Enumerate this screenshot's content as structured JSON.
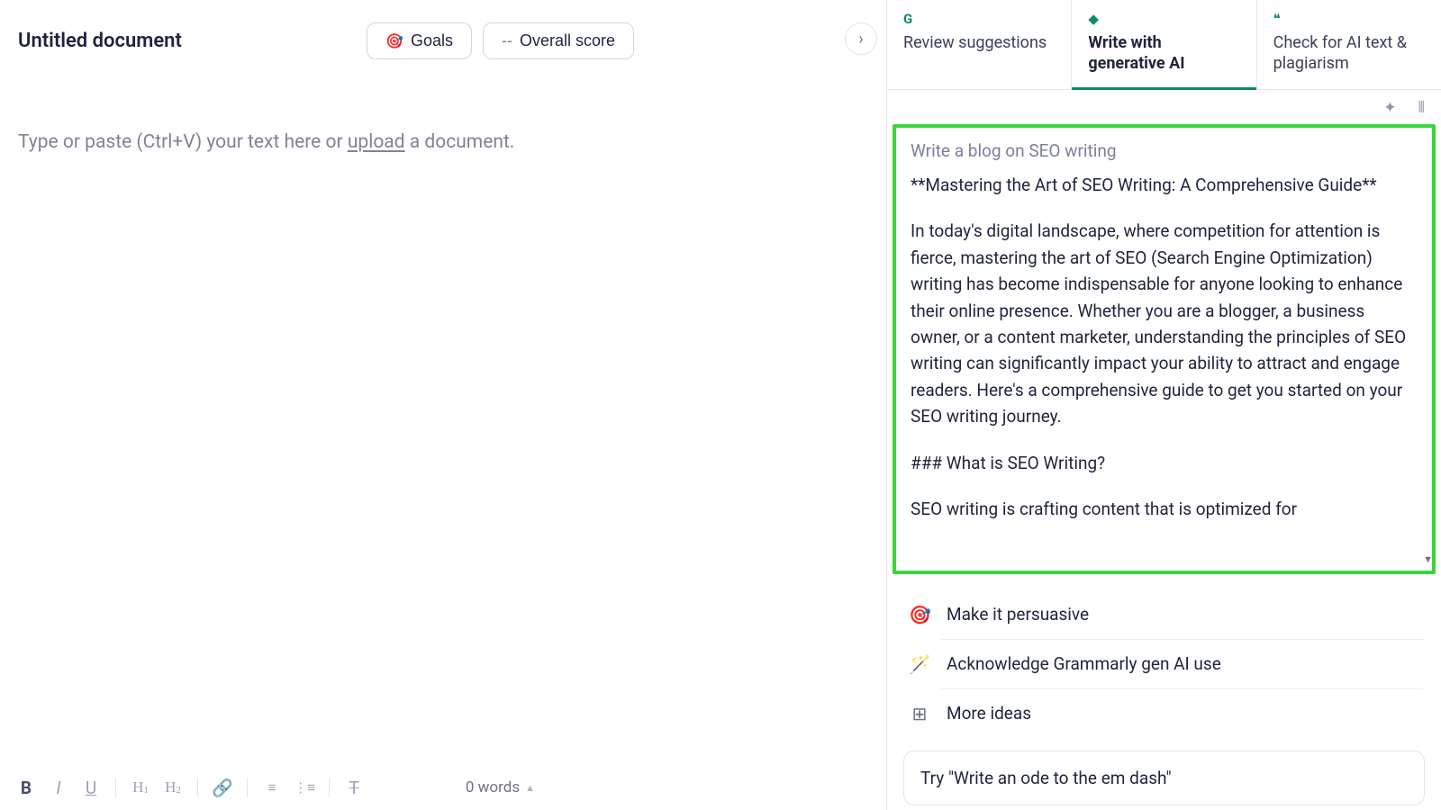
{
  "doc": {
    "title": "Untitled document",
    "placeholder_prefix": "Type or paste (Ctrl+V) your text here or ",
    "placeholder_upload": "upload",
    "placeholder_suffix": " a document.",
    "word_count": "0 words"
  },
  "header_buttons": {
    "goals": "Goals",
    "overall_score_prefix": "--",
    "overall_score": " Overall score"
  },
  "tabs": {
    "review": "Review suggestions",
    "write_ai": "Write with generative AI",
    "check_ai": "Check for AI text & plagiarism"
  },
  "ai_card": {
    "prompt": "Write a blog on SEO writing",
    "title_line": "**Mastering the Art of SEO Writing: A Comprehensive Guide**",
    "para1": "In today's digital landscape, where competition for attention is fierce, mastering the art of SEO (Search Engine Optimization) writing has become indispensable for anyone looking to enhance their online presence. Whether you are a blogger, a business owner, or a content marketer, understanding the principles of SEO writing can significantly impact your ability to attract and engage readers. Here's a comprehensive guide to get you started on your SEO writing journey.",
    "heading2": "### What is SEO Writing?",
    "para2": "SEO writing is crafting content that is optimized for"
  },
  "actions": {
    "persuasive": "Make it persuasive",
    "acknowledge": "Acknowledge Grammarly gen AI use",
    "more_ideas": "More ideas"
  },
  "prompt_suggestion": "Try \"Write an ode to the em dash\"",
  "icons": {
    "goals": "🎯",
    "review": "G",
    "write_ai": "◆",
    "check_ai": "❝",
    "sparkle": "✦",
    "sound": "⦀",
    "persuasive": "🎯",
    "acknowledge": "🪄",
    "more_ideas": "⊞"
  }
}
